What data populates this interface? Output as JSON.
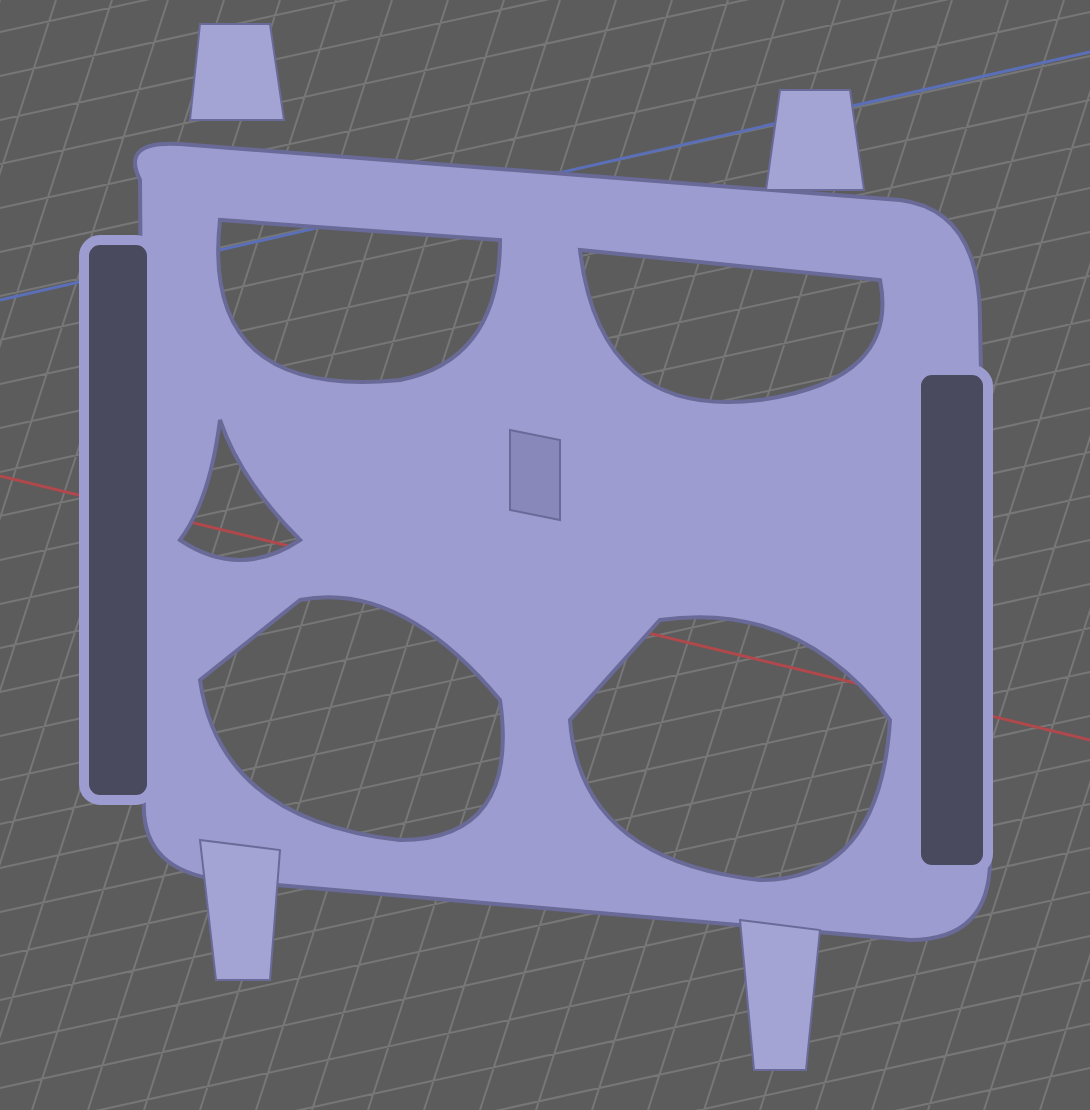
{
  "viewport": {
    "grid": true,
    "axes": true
  }
}
